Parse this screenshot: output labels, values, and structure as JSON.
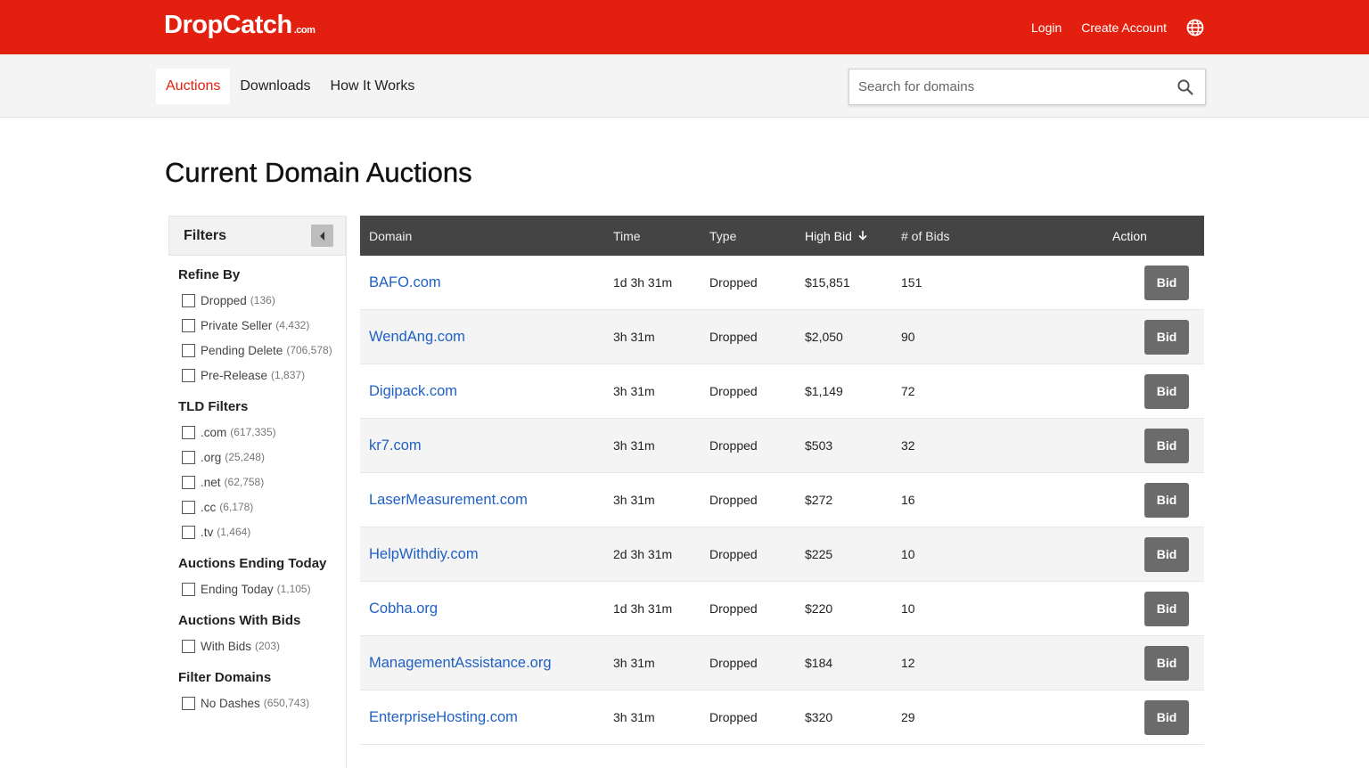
{
  "brand": {
    "logo": "DropCatch",
    "logo_suffix": ".com"
  },
  "topnav": {
    "login": "Login",
    "create_account": "Create Account",
    "globe_icon": "globe-icon"
  },
  "nav": {
    "tabs": [
      {
        "label": "Auctions",
        "active": true
      },
      {
        "label": "Downloads",
        "active": false
      },
      {
        "label": "How It Works",
        "active": false
      }
    ],
    "search_placeholder": "Search for domains"
  },
  "page_title": "Current Domain Auctions",
  "filters": {
    "title": "Filters",
    "groups": [
      {
        "title": "Refine By",
        "items": [
          {
            "label": "Dropped",
            "count": "(136)"
          },
          {
            "label": "Private Seller",
            "count": "(4,432)"
          },
          {
            "label": "Pending Delete",
            "count": "(706,578)"
          },
          {
            "label": "Pre-Release",
            "count": "(1,837)"
          }
        ]
      },
      {
        "title": "TLD Filters",
        "items": [
          {
            "label": ".com",
            "count": "(617,335)"
          },
          {
            "label": ".org",
            "count": "(25,248)"
          },
          {
            "label": ".net",
            "count": "(62,758)"
          },
          {
            "label": ".cc",
            "count": "(6,178)"
          },
          {
            "label": ".tv",
            "count": "(1,464)"
          }
        ]
      },
      {
        "title": "Auctions Ending Today",
        "items": [
          {
            "label": "Ending Today",
            "count": "(1,105)"
          }
        ]
      },
      {
        "title": "Auctions With Bids",
        "items": [
          {
            "label": "With Bids",
            "count": "(203)"
          }
        ]
      },
      {
        "title": "Filter Domains",
        "items": [
          {
            "label": "No Dashes",
            "count": "(650,743)"
          }
        ]
      }
    ]
  },
  "table": {
    "headers": {
      "domain": "Domain",
      "time": "Time",
      "type": "Type",
      "high_bid": "High Bid",
      "num_bids": "# of Bids",
      "action": "Action"
    },
    "rows": [
      {
        "domain": "BAFO.com",
        "time": "1d 3h 31m",
        "type": "Dropped",
        "high_bid": "$15,851",
        "num_bids": "151",
        "action": "Bid"
      },
      {
        "domain": "WendAng.com",
        "time": "3h 31m",
        "type": "Dropped",
        "high_bid": "$2,050",
        "num_bids": "90",
        "action": "Bid"
      },
      {
        "domain": "Digipack.com",
        "time": "3h 31m",
        "type": "Dropped",
        "high_bid": "$1,149",
        "num_bids": "72",
        "action": "Bid"
      },
      {
        "domain": "kr7.com",
        "time": "3h 31m",
        "type": "Dropped",
        "high_bid": "$503",
        "num_bids": "32",
        "action": "Bid"
      },
      {
        "domain": "LaserMeasurement.com",
        "time": "3h 31m",
        "type": "Dropped",
        "high_bid": "$272",
        "num_bids": "16",
        "action": "Bid"
      },
      {
        "domain": "HelpWithdiy.com",
        "time": "2d 3h 31m",
        "type": "Dropped",
        "high_bid": "$225",
        "num_bids": "10",
        "action": "Bid"
      },
      {
        "domain": "Cobha.org",
        "time": "1d 3h 31m",
        "type": "Dropped",
        "high_bid": "$220",
        "num_bids": "10",
        "action": "Bid"
      },
      {
        "domain": "ManagementAssistance.org",
        "time": "3h 31m",
        "type": "Dropped",
        "high_bid": "$184",
        "num_bids": "12",
        "action": "Bid"
      },
      {
        "domain": "EnterpriseHosting.com",
        "time": "3h 31m",
        "type": "Dropped",
        "high_bid": "$320",
        "num_bids": "29",
        "action": "Bid"
      }
    ]
  },
  "colors": {
    "brand_red": "#e3200f",
    "link_blue": "#1f60c4",
    "header_dark": "#444444",
    "bid_button": "#6b6b6b"
  }
}
